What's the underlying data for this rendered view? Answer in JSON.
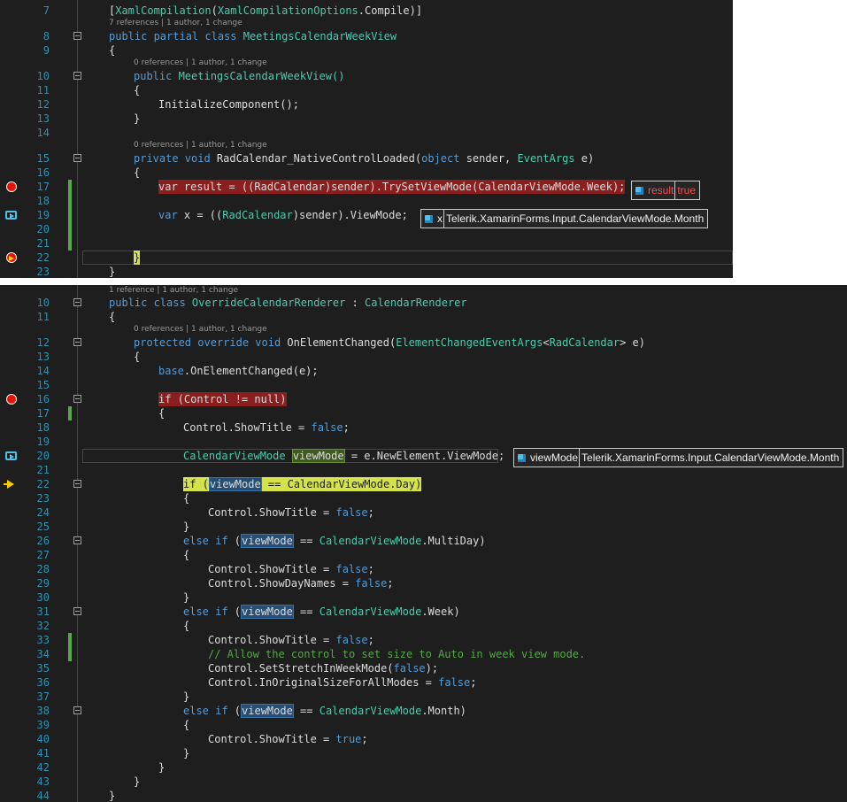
{
  "colors": {
    "editor_bg": "#1e1e1e",
    "breakpoint": "#e51400",
    "line_number": "#2b91af",
    "keyword": "#569cd6",
    "type": "#4ec9b0",
    "comment": "#57a64a",
    "change_bar": "#57a64a",
    "breakpoint_hl": "#8b1e1e",
    "current_stmt_hl": "#d4e34a"
  },
  "panel1": {
    "lines": {
      "l7": "7",
      "l8": "8",
      "l9": "9",
      "l10": "10",
      "l11": "11",
      "l12": "12",
      "l13": "13",
      "l14": "14",
      "l15": "15",
      "l16": "16",
      "l17": "17",
      "l18": "18",
      "l19": "19",
      "l20": "20",
      "l21": "21",
      "l22": "22",
      "l23": "23"
    },
    "lens": {
      "class": "7 references | 1 author, 1 change",
      "ctor": "0 references | 1 author, 1 change",
      "handler": "0 references | 1 author, 1 change"
    },
    "code": {
      "attr_open": "[",
      "attr_type": "XamlCompilation",
      "attr_mid": "(",
      "attr_type2": "XamlCompilationOptions",
      "attr_end": ".Compile)]",
      "l8_kw": "public partial class ",
      "l8_type": "MeetingsCalendarWeekView",
      "l9": "{",
      "l10_kw": "public ",
      "l10_rest": "MeetingsCalendarWeekView()",
      "l11": "{",
      "l12": "InitializeComponent();",
      "l13": "}",
      "l15_kw": "private void ",
      "l15_name": "RadCalendar_NativeControlLoaded(",
      "l15_kw2": "object",
      "l15_p1": " sender, ",
      "l15_type": "EventArgs",
      "l15_p2": " e)",
      "l16": "{",
      "l17": "var result = ((RadCalendar)sender).TrySetViewMode(CalendarViewMode.Week);",
      "l19_kw": "var",
      "l19_a": " x = ((",
      "l19_type": "RadCalendar",
      "l19_b": ")sender).ViewMode;",
      "l22": "}",
      "l23": "}"
    },
    "tips": {
      "result_name": "result",
      "result_value": "true",
      "x_name": "x",
      "x_value": "Telerik.XamarinForms.Input.CalendarViewMode.Month"
    }
  },
  "panel2": {
    "lines": {
      "l10": "10",
      "l11": "11",
      "l12": "12",
      "l13": "13",
      "l14": "14",
      "l15": "15",
      "l16": "16",
      "l17": "17",
      "l18": "18",
      "l19": "19",
      "l20": "20",
      "l21": "21",
      "l22": "22",
      "l23": "23",
      "l24": "24",
      "l25": "25",
      "l26": "26",
      "l27": "27",
      "l28": "28",
      "l29": "29",
      "l30": "30",
      "l31": "31",
      "l32": "32",
      "l33": "33",
      "l34": "34",
      "l35": "35",
      "l36": "36",
      "l37": "37",
      "l38": "38",
      "l39": "39",
      "l40": "40",
      "l41": "41",
      "l42": "42",
      "l43": "43",
      "l44": "44"
    },
    "lens": {
      "class": "1 reference | 1 author, 1 change",
      "method": "0 references | 1 author, 1 change"
    },
    "code": {
      "l10_kw": "public class ",
      "l10_type": "OverrideCalendarRenderer",
      "l10_mid": " : ",
      "l10_type2": "CalendarRenderer",
      "l11": "{",
      "l12_kw": "protected override void ",
      "l12_name": "OnElementChanged(",
      "l12_type": "ElementChangedEventArgs",
      "l12_lt": "<",
      "l12_type2": "RadCalendar",
      "l12_end": "> e)",
      "l13": "{",
      "l14_kw": "base",
      "l14_rest": ".OnElementChanged(e);",
      "l16": "if (Control != null)",
      "l17": "{",
      "l18_a": "Control.ShowTitle = ",
      "l18_kw": "false",
      "l18_b": ";",
      "l20_type": "CalendarViewMode",
      "l20_sp": " ",
      "l20_var": "viewMode",
      "l20_rest": " = e.NewElement.ViewMode;",
      "l22_if": "if (",
      "l22_var": "viewMode",
      "l22_rest": " == CalendarViewMode.Day)",
      "l23": "{",
      "l24_a": "Control.ShowTitle = ",
      "l24_kw": "false",
      "l24_b": ";",
      "l25": "}",
      "l26_kw": "else if",
      "l26_a": " (",
      "l26_var": "viewMode",
      "l26_b": " == ",
      "l26_type": "CalendarViewMode",
      "l26_c": ".MultiDay)",
      "l27": "{",
      "l28_a": "Control.ShowTitle = ",
      "l28_kw": "false",
      "l28_b": ";",
      "l29_a": "Control.ShowDayNames = ",
      "l29_kw": "false",
      "l29_b": ";",
      "l30": "}",
      "l31_kw": "else if",
      "l31_a": " (",
      "l31_var": "viewMode",
      "l31_b": " == ",
      "l31_type": "CalendarViewMode",
      "l31_c": ".Week)",
      "l32": "{",
      "l33_a": "Control.ShowTitle = ",
      "l33_kw": "false",
      "l33_b": ";",
      "l34": "// Allow the control to set size to Auto in week view mode.",
      "l35_a": "Control.SetStretchInWeekMode(",
      "l35_kw": "false",
      "l35_b": ");",
      "l36_a": "Control.InOriginalSizeForAllModes = ",
      "l36_kw": "false",
      "l36_b": ";",
      "l37": "}",
      "l38_kw": "else if",
      "l38_a": " (",
      "l38_var": "viewMode",
      "l38_b": " == ",
      "l38_type": "CalendarViewMode",
      "l38_c": ".Month)",
      "l39": "{",
      "l40_a": "Control.ShowTitle = ",
      "l40_kw": "true",
      "l40_b": ";",
      "l41": "}",
      "l42": "}",
      "l43": "}",
      "l44": "}"
    },
    "tips": {
      "vm_name": "viewMode",
      "vm_value": "Telerik.XamarinForms.Input.CalendarViewMode.Month"
    }
  }
}
